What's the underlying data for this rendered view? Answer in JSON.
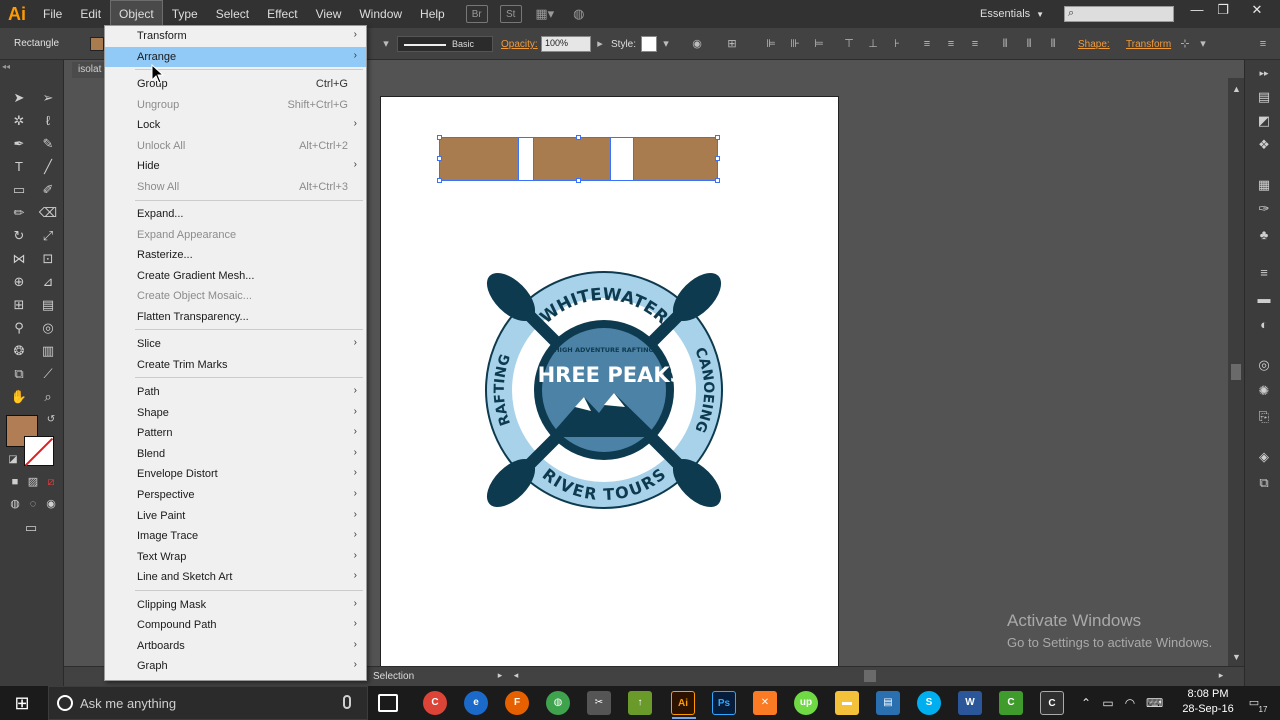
{
  "app": {
    "logo": "Ai",
    "menus": [
      "File",
      "Edit",
      "Object",
      "Type",
      "Select",
      "Effect",
      "View",
      "Window",
      "Help"
    ],
    "active_menu": "Object",
    "workspace": "Essentials"
  },
  "control_bar": {
    "tool_name": "Rectangle",
    "stroke_profile": "Basic",
    "opacity_label": "Opacity:",
    "opacity_value": "100%",
    "style_label": "Style:",
    "shape_label": "Shape:",
    "transform_label": "Transform"
  },
  "document": {
    "tab_label": "isolat",
    "status": "Selection"
  },
  "object_menu": {
    "items": [
      {
        "label": "Transform",
        "shortcut": "",
        "submenu": true,
        "disabled": false
      },
      {
        "label": "Arrange",
        "shortcut": "",
        "submenu": true,
        "disabled": false,
        "highlight": true
      },
      {
        "label": "Group",
        "shortcut": "Ctrl+G",
        "submenu": false,
        "disabled": false
      },
      {
        "label": "Ungroup",
        "shortcut": "Shift+Ctrl+G",
        "submenu": false,
        "disabled": true
      },
      {
        "label": "Lock",
        "shortcut": "",
        "submenu": true,
        "disabled": false
      },
      {
        "label": "Unlock All",
        "shortcut": "Alt+Ctrl+2",
        "submenu": false,
        "disabled": true
      },
      {
        "label": "Hide",
        "shortcut": "",
        "submenu": true,
        "disabled": false
      },
      {
        "label": "Show All",
        "shortcut": "Alt+Ctrl+3",
        "submenu": false,
        "disabled": true
      },
      {
        "label": "Expand...",
        "shortcut": "",
        "submenu": false,
        "disabled": false
      },
      {
        "label": "Expand Appearance",
        "shortcut": "",
        "submenu": false,
        "disabled": true
      },
      {
        "label": "Rasterize...",
        "shortcut": "",
        "submenu": false,
        "disabled": false
      },
      {
        "label": "Create Gradient Mesh...",
        "shortcut": "",
        "submenu": false,
        "disabled": false
      },
      {
        "label": "Create Object Mosaic...",
        "shortcut": "",
        "submenu": false,
        "disabled": true
      },
      {
        "label": "Flatten Transparency...",
        "shortcut": "",
        "submenu": false,
        "disabled": false
      },
      {
        "label": "Slice",
        "shortcut": "",
        "submenu": true,
        "disabled": false
      },
      {
        "label": "Create Trim Marks",
        "shortcut": "",
        "submenu": false,
        "disabled": false
      },
      {
        "label": "Path",
        "shortcut": "",
        "submenu": true,
        "disabled": false
      },
      {
        "label": "Shape",
        "shortcut": "",
        "submenu": true,
        "disabled": false
      },
      {
        "label": "Pattern",
        "shortcut": "",
        "submenu": true,
        "disabled": false
      },
      {
        "label": "Blend",
        "shortcut": "",
        "submenu": true,
        "disabled": false
      },
      {
        "label": "Envelope Distort",
        "shortcut": "",
        "submenu": true,
        "disabled": false
      },
      {
        "label": "Perspective",
        "shortcut": "",
        "submenu": true,
        "disabled": false
      },
      {
        "label": "Live Paint",
        "shortcut": "",
        "submenu": true,
        "disabled": false
      },
      {
        "label": "Image Trace",
        "shortcut": "",
        "submenu": true,
        "disabled": false
      },
      {
        "label": "Text Wrap",
        "shortcut": "",
        "submenu": true,
        "disabled": false
      },
      {
        "label": "Line and Sketch Art",
        "shortcut": "",
        "submenu": true,
        "disabled": false
      },
      {
        "label": "Clipping Mask",
        "shortcut": "",
        "submenu": true,
        "disabled": false
      },
      {
        "label": "Compound Path",
        "shortcut": "",
        "submenu": true,
        "disabled": false
      },
      {
        "label": "Artboards",
        "shortcut": "",
        "submenu": true,
        "disabled": false
      },
      {
        "label": "Graph",
        "shortcut": "",
        "submenu": true,
        "disabled": false
      }
    ]
  },
  "artwork": {
    "logo_top_text": "WHITEWATER",
    "logo_left_text": "RAFTING",
    "logo_right_text": "CANOEING",
    "logo_bottom_text": "RIVER TOURS",
    "logo_tagline": "HIGH ADVENTURE RAFTING",
    "logo_title": "THREE PEAKS",
    "fill_color": "#a97c50",
    "dark_color": "#0d3a4f",
    "mid_color": "#4b82a6",
    "light_color": "#a7d2ea"
  },
  "watermark": {
    "title": "Activate Windows",
    "subtitle": "Go to Settings to activate Windows."
  },
  "taskbar": {
    "search_placeholder": "Ask me anything",
    "time": "8:08 PM",
    "date": "28-Sep-16",
    "notification_count": "17",
    "apps": [
      "Chrome",
      "IE",
      "Firefox",
      "Globe",
      "Tools",
      "Upload",
      "Illustrator",
      "Photoshop",
      "XAMPP",
      "Upwork",
      "Explorer",
      "Network",
      "Skype",
      "Word",
      "Camtasia",
      "Recorder"
    ]
  }
}
